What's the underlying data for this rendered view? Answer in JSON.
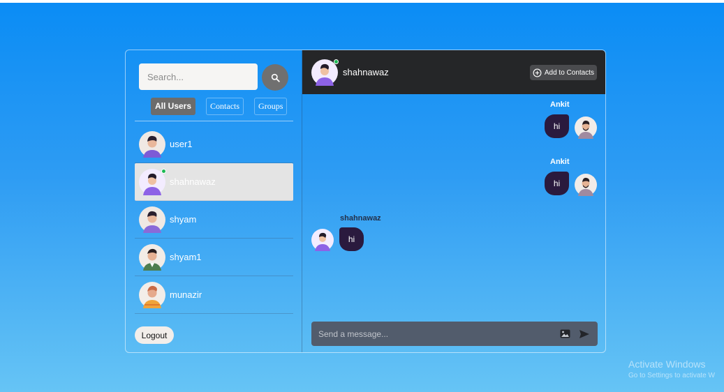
{
  "search": {
    "placeholder": "Search..."
  },
  "tabs": [
    {
      "label": "All Users",
      "active": true
    },
    {
      "label": "Contacts",
      "active": false
    },
    {
      "label": "Groups",
      "active": false
    }
  ],
  "users": [
    {
      "name": "user1",
      "online": false,
      "selected": false
    },
    {
      "name": "shahnawaz",
      "online": true,
      "selected": true
    },
    {
      "name": "shyam",
      "online": false,
      "selected": false
    },
    {
      "name": "shyam1",
      "online": false,
      "selected": false
    },
    {
      "name": "munazir",
      "online": false,
      "selected": false
    }
  ],
  "logout_label": "Logout",
  "chat_header": {
    "name": "shahnawaz",
    "online": true,
    "add_contact_label": "Add to Contacts"
  },
  "messages": [
    {
      "sender": "Ankit",
      "text": "hi",
      "side": "right"
    },
    {
      "sender": "Ankit",
      "text": "hi",
      "side": "right"
    },
    {
      "sender": "shahnawaz",
      "text": "hi",
      "side": "left"
    }
  ],
  "composer": {
    "placeholder": "Send a message..."
  },
  "watermark": {
    "line1": "Activate Windows",
    "line2": "Go to Settings to activate W"
  },
  "colors": {
    "accent_bg": "#0a8cf5",
    "header_bg": "#252628",
    "bubble_bg": "#2a1a3e",
    "online": "#1db954"
  },
  "icons": [
    "search-icon",
    "add-circle-icon",
    "image-icon",
    "send-icon"
  ]
}
